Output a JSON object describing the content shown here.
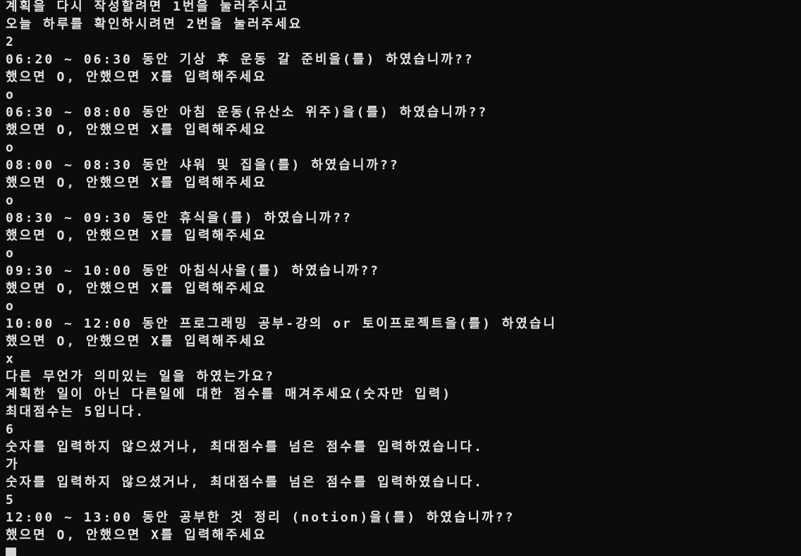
{
  "terminal": {
    "lines": [
      "계획을 다시 작성할려면 1번을 눌러주시고",
      "오늘 하루를 확인하시려면 2번을 눌러주세요",
      "2",
      "06:20 ~ 06:30 동안 기상 후 운동 갈 준비을(를) 하였습니까??",
      "했으면 O, 안했으면 X를 입력해주세요",
      "o",
      "06:30 ~ 08:00 동안 아침 운동(유산소 위주)을(를) 하였습니까??",
      "했으면 O, 안했으면 X를 입력해주세요",
      "o",
      "08:00 ~ 08:30 동안 샤워 및 집을(를) 하였습니까??",
      "했으면 O, 안했으면 X를 입력해주세요",
      "o",
      "08:30 ~ 09:30 동안 휴식을(를) 하였습니까??",
      "했으면 O, 안했으면 X를 입력해주세요",
      "o",
      "09:30 ~ 10:00 동안 아침식사을(를) 하였습니까??",
      "했으면 O, 안했으면 X를 입력해주세요",
      "o",
      "10:00 ~ 12:00 동안 프로그래밍 공부-강의 or 토이프로젝트을(를) 하였습니",
      "했으면 O, 안했으면 X를 입력해주세요",
      "x",
      "다른 무언가 의미있는 일을 하였는가요?",
      "계획한 일이 아닌 다른일에 대한 점수를 매겨주세요(숫자만 입력)",
      "최대점수는 5입니다.",
      "6",
      "숫자를 입력하지 않으셨거나, 최대점수를 넘은 점수를 입력하였습니다.",
      "가",
      "숫자를 입력하지 않으셨거나, 최대점수를 넘은 점수를 입력하였습니다.",
      "5",
      "12:00 ~ 13:00 동안 공부한 것 정리 (notion)을(를) 하였습니까??",
      "했으면 O, 안했으면 X를 입력해주세요"
    ]
  }
}
